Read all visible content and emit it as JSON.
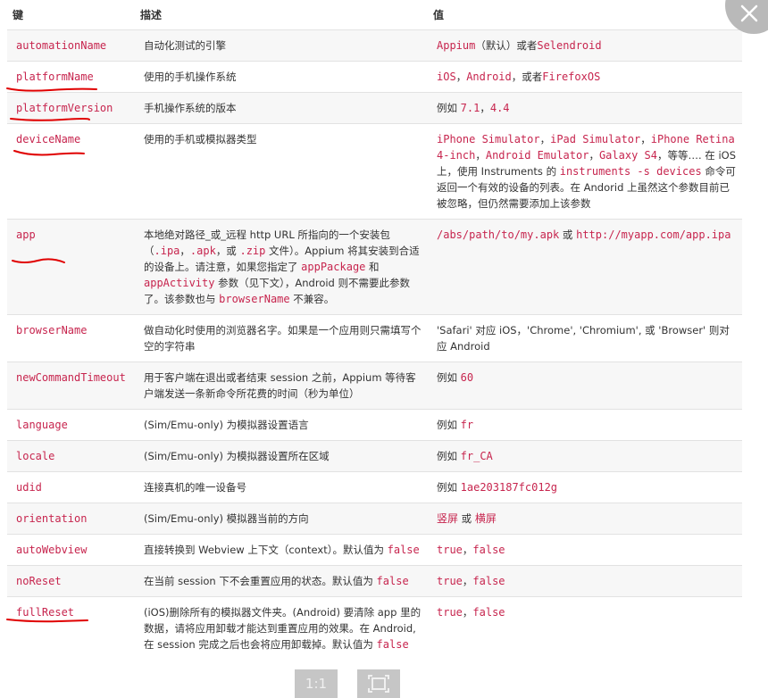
{
  "header": {
    "key": "键",
    "desc": "描述",
    "value": "值"
  },
  "rows": [
    {
      "key": "automationName",
      "desc": [
        {
          "t": "自动化测试的引擎"
        }
      ],
      "value": [
        {
          "c": "Appium"
        },
        {
          "t": "（默认）或者"
        },
        {
          "c": "Selendroid"
        }
      ]
    },
    {
      "key": "platformName",
      "desc": [
        {
          "t": "使用的手机操作系统"
        }
      ],
      "value": [
        {
          "c": "iOS"
        },
        {
          "t": "，"
        },
        {
          "c": "Android"
        },
        {
          "t": "，或者"
        },
        {
          "c": "FirefoxOS"
        }
      ]
    },
    {
      "key": "platformVersion",
      "desc": [
        {
          "t": "手机操作系统的版本"
        }
      ],
      "value": [
        {
          "t": "例如 "
        },
        {
          "c": "7.1"
        },
        {
          "t": "，"
        },
        {
          "c": "4.4"
        }
      ]
    },
    {
      "key": "deviceName",
      "desc": [
        {
          "t": "使用的手机或模拟器类型"
        }
      ],
      "value": [
        {
          "c": "iPhone Simulator"
        },
        {
          "t": "，"
        },
        {
          "c": "iPad Simulator"
        },
        {
          "t": "，"
        },
        {
          "c": "iPhone Retina 4-inch"
        },
        {
          "t": "，"
        },
        {
          "c": "Android Emulator"
        },
        {
          "t": "，"
        },
        {
          "c": "Galaxy S4"
        },
        {
          "t": "，等等…. 在 iOS 上，使用 Instruments 的 "
        },
        {
          "c": "instruments -s devices"
        },
        {
          "t": " 命令可返回一个有效的设备的列表。在 Andorid 上虽然这个参数目前已被忽略，但仍然需要添加上该参数"
        }
      ]
    },
    {
      "key": "app",
      "desc": [
        {
          "t": "本地绝对路径_或_远程 http URL 所指向的一个安装包（"
        },
        {
          "c": ".ipa"
        },
        {
          "t": "，"
        },
        {
          "c": ".apk"
        },
        {
          "t": "，或 "
        },
        {
          "c": ".zip"
        },
        {
          "t": " 文件）。Appium 将其安装到合适的设备上。请注意，如果您指定了 "
        },
        {
          "c": "appPackage"
        },
        {
          "t": " 和 "
        },
        {
          "c": "appActivity"
        },
        {
          "t": " 参数（见下文），Android 则不需要此参数了。该参数也与 "
        },
        {
          "c": "browserName"
        },
        {
          "t": " 不兼容。"
        }
      ],
      "value": [
        {
          "c": "/abs/path/to/my.apk"
        },
        {
          "t": " 或 "
        },
        {
          "c": "http://myapp.com/app.ipa"
        }
      ]
    },
    {
      "key": "browserName",
      "desc": [
        {
          "t": "做自动化时使用的浏览器名字。如果是一个应用则只需填写个空的字符串"
        }
      ],
      "value": [
        {
          "t": "'Safari' 对应 iOS，'Chrome', 'Chromium', 或 'Browser' 则对应 Android"
        }
      ]
    },
    {
      "key": "newCommandTimeout",
      "desc": [
        {
          "t": "用于客户端在退出或者结束 session 之前，Appium 等待客户端发送一条新命令所花费的时间（秒为单位）"
        }
      ],
      "value": [
        {
          "t": "例如 "
        },
        {
          "c": "60"
        }
      ]
    },
    {
      "key": "language",
      "desc": [
        {
          "t": "(Sim/Emu-only) 为模拟器设置语言"
        }
      ],
      "value": [
        {
          "t": "例如 "
        },
        {
          "c": "fr"
        }
      ]
    },
    {
      "key": "locale",
      "desc": [
        {
          "t": "(Sim/Emu-only) 为模拟器设置所在区域"
        }
      ],
      "value": [
        {
          "t": "例如 "
        },
        {
          "c": "fr_CA"
        }
      ]
    },
    {
      "key": "udid",
      "desc": [
        {
          "t": "连接真机的唯一设备号"
        }
      ],
      "value": [
        {
          "t": "例如 "
        },
        {
          "c": "1ae203187fc012g"
        }
      ]
    },
    {
      "key": "orientation",
      "desc": [
        {
          "t": "(Sim/Emu-only) 模拟器当前的方向"
        }
      ],
      "value": [
        {
          "c": "竖屏"
        },
        {
          "t": " 或 "
        },
        {
          "c": "横屏"
        }
      ]
    },
    {
      "key": "autoWebview",
      "desc": [
        {
          "t": "直接转换到 Webview 上下文（context）。默认值为 "
        },
        {
          "c": "false"
        }
      ],
      "value": [
        {
          "c": "true"
        },
        {
          "t": "，"
        },
        {
          "c": "false"
        }
      ]
    },
    {
      "key": "noReset",
      "desc": [
        {
          "t": "在当前 session 下不会重置应用的状态。默认值为 "
        },
        {
          "c": "false"
        }
      ],
      "value": [
        {
          "c": "true"
        },
        {
          "t": "，"
        },
        {
          "c": "false"
        }
      ]
    },
    {
      "key": "fullReset",
      "desc": [
        {
          "t": "(iOS)删除所有的模拟器文件夹。(Android) 要清除 app 里的数据，请将应用卸载才能达到重置应用的效果。在 Android, 在 session 完成之后也会将应用卸载掉。默认值为 "
        },
        {
          "c": "false"
        }
      ],
      "value": [
        {
          "c": "true"
        },
        {
          "t": "，"
        },
        {
          "c": "false"
        }
      ]
    }
  ],
  "viewer": {
    "zoom_label": "1:1",
    "fit_icon": "fit-screen-icon",
    "close_icon": "close-icon"
  },
  "colors": {
    "code": "#c7254e",
    "annotation": "#e00000",
    "stripe": "#f7f7f7"
  }
}
